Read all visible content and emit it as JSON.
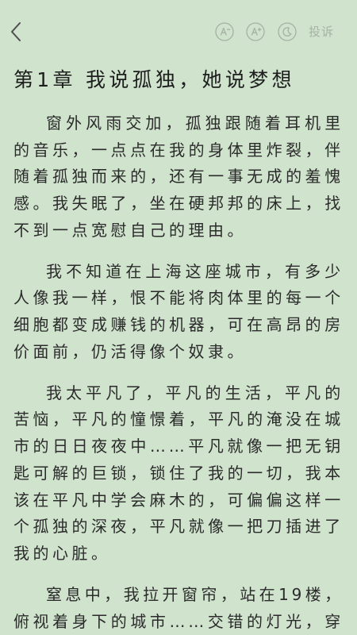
{
  "colors": {
    "background": "#cfe3cd",
    "text": "#2b2b2b",
    "title": "#1e1e1e",
    "icon": "#a6b2a4",
    "back_icon": "#4d4d4d"
  },
  "toolbar": {
    "back_icon": "chevron-left-icon",
    "font_decrease_icon": "font-decrease-icon",
    "font_increase_icon": "font-increase-icon",
    "night_mode_icon": "moon-icon",
    "report_label": "投诉"
  },
  "chapter": {
    "title": "第1章 我说孤独，她说梦想",
    "paragraphs": [
      {
        "lines": [
          "窗外风雨交加，孤独跟随着耳机里",
          "的音乐，一点点在我的身体里炸裂，伴",
          "随着孤独而来的，还有一事无成的羞愧",
          "感。我失眠了，坐在硬邦邦的床上，找",
          "不到一点宽慰自己的理由。"
        ]
      },
      {
        "lines": [
          "我不知道在上海这座城市，有多少",
          "人像我一样，恨不能将肉体里的每一个",
          "细胞都变成赚钱的机器，可在高昂的房",
          "价面前，仍活得像个奴隶。"
        ]
      },
      {
        "lines": [
          "我太平凡了，平凡的生活，平凡的",
          "苦恼，平凡的憧憬着，平凡的淹没在城",
          "市的日日夜夜中……平凡就像一把无钥",
          "匙可解的巨锁，锁住了我的一切，我本",
          "该在平凡中学会麻木的，可偏偏这样一",
          "个孤独的深夜，平凡就像一把刀插进了",
          "我的心脏。"
        ]
      },
      {
        "lines": [
          "窒息中，我拉开窗帘，站在19楼，",
          "俯视着身下的城市……交错的灯光，穿"
        ]
      }
    ]
  }
}
